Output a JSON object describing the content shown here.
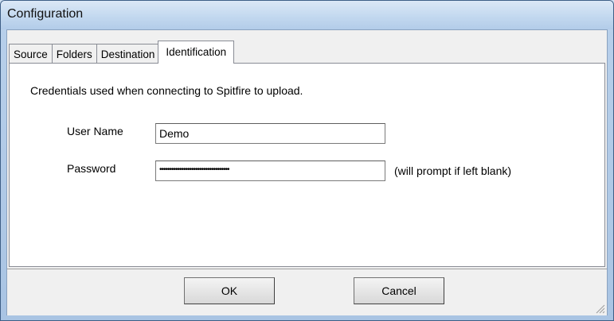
{
  "window": {
    "title": "Configuration"
  },
  "tabs": [
    {
      "label": "Source",
      "active": false
    },
    {
      "label": "Folders",
      "active": false
    },
    {
      "label": "Destination",
      "active": false
    },
    {
      "label": "Identification",
      "active": true
    }
  ],
  "identification": {
    "description": "Credentials used when connecting to Spitfire to upload.",
    "username_label": "User Name",
    "username_value": "Demo",
    "password_label": "Password",
    "password_mask": "•••••••••••••••••••••••••••••••••••",
    "password_hint": "(will prompt if left blank)"
  },
  "buttons": {
    "ok_label": "OK",
    "cancel_label": "Cancel"
  },
  "icons": {
    "resize_grip": "size-grip-icon"
  }
}
